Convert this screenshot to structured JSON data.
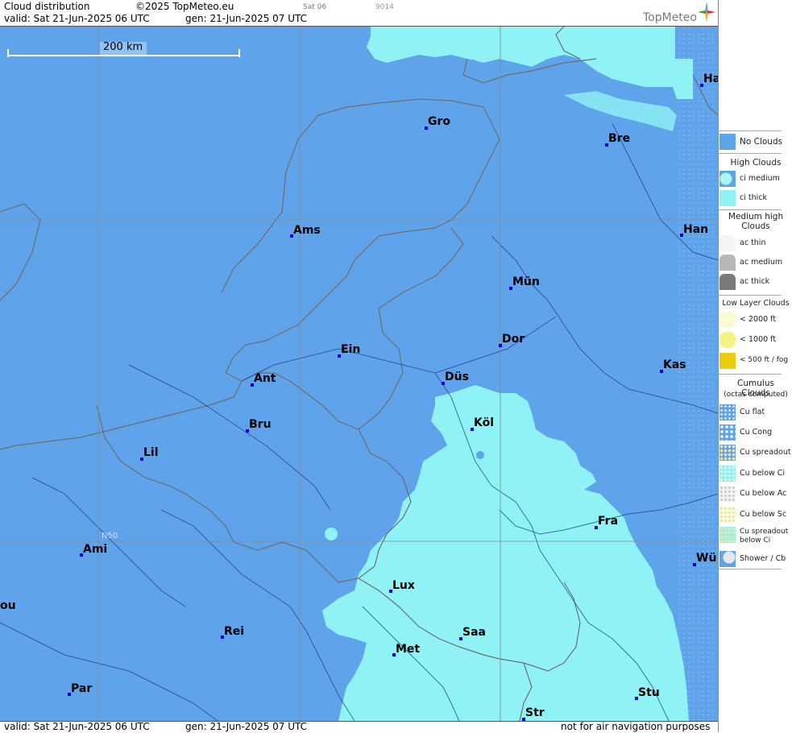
{
  "header": {
    "title": "Cloud distribution",
    "copyright": "©2025 TopMeteo.eu",
    "model_tag": "Sat 06",
    "code": "9014",
    "valid": "valid:  Sat  21-Jun-2025  06 UTC",
    "gen": "gen: 21-Jun-2025 07 UTC",
    "logo_text": "TopMeteo"
  },
  "map": {
    "scale_label": "200 km",
    "lat_label": "N50",
    "colors": {
      "no_clouds": "#5fa3ea",
      "ci_thick": "#8ff3f6",
      "border": "#6e6e6e",
      "grid": "#888888"
    },
    "cities": [
      {
        "name": "Gro"
      },
      {
        "name": "Bre"
      },
      {
        "name": "Ha"
      },
      {
        "name": "Ams"
      },
      {
        "name": "Han"
      },
      {
        "name": "Mün"
      },
      {
        "name": "Ein"
      },
      {
        "name": "Dor"
      },
      {
        "name": "Kas"
      },
      {
        "name": "Ant"
      },
      {
        "name": "Düs"
      },
      {
        "name": "Köl"
      },
      {
        "name": "Bru"
      },
      {
        "name": "Lil"
      },
      {
        "name": "Fra"
      },
      {
        "name": "Ami"
      },
      {
        "name": "Wü"
      },
      {
        "name": "Lux"
      },
      {
        "name": "ou"
      },
      {
        "name": "Rei"
      },
      {
        "name": "Saa"
      },
      {
        "name": "Met"
      },
      {
        "name": "Par"
      },
      {
        "name": "Stu"
      },
      {
        "name": "Str"
      }
    ]
  },
  "footer": {
    "valid": "valid:  Sat  21-Jun-2025  06 UTC",
    "gen": "gen: 21-Jun-2025 07 UTC",
    "note": "not for air navigation purposes"
  },
  "legend": {
    "no_clouds": "No Clouds",
    "high_title": "High Clouds",
    "ci_medium": "ci medium",
    "ci_thick": "ci thick",
    "medium_title": "Medium high Clouds",
    "ac_thin": "ac thin",
    "ac_medium": "ac medium",
    "ac_thick": "ac thick",
    "low_title": "Low Layer Clouds",
    "low_2000": "< 2000 ft",
    "low_1000": "< 1000 ft",
    "low_500": "< 500 ft / fog",
    "cu_title": "Cumulus Clouds",
    "cu_sub": "(octas computed)",
    "cu_flat": "Cu flat",
    "cu_cong": "Cu Cong",
    "cu_spread": "Cu spreadout",
    "cu_below_ci": "Cu below Ci",
    "cu_below_ac": "Cu below Ac",
    "cu_below_sc": "Cu below Sc",
    "cu_spread_below_ci": "Cu spreadout below Ci",
    "shower": "Shower / Cb"
  }
}
